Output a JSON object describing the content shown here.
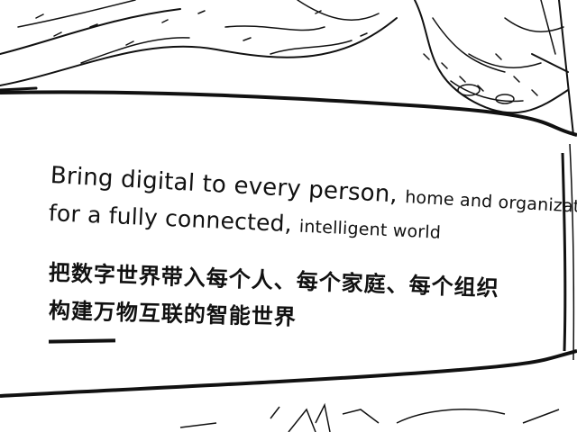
{
  "slogan": {
    "english": {
      "line1_main": "Bring digital to every person, ",
      "line1_tail": "home and organization",
      "line2_main": "for a fully connected, ",
      "line2_tail": "intelligent world"
    },
    "chinese": {
      "line1": "把数字世界带入每个人、每个家庭、每个组织",
      "line2": "构建万物互联的智能世界"
    }
  },
  "colors": {
    "ink": "#111111",
    "background": "#ffffff"
  }
}
